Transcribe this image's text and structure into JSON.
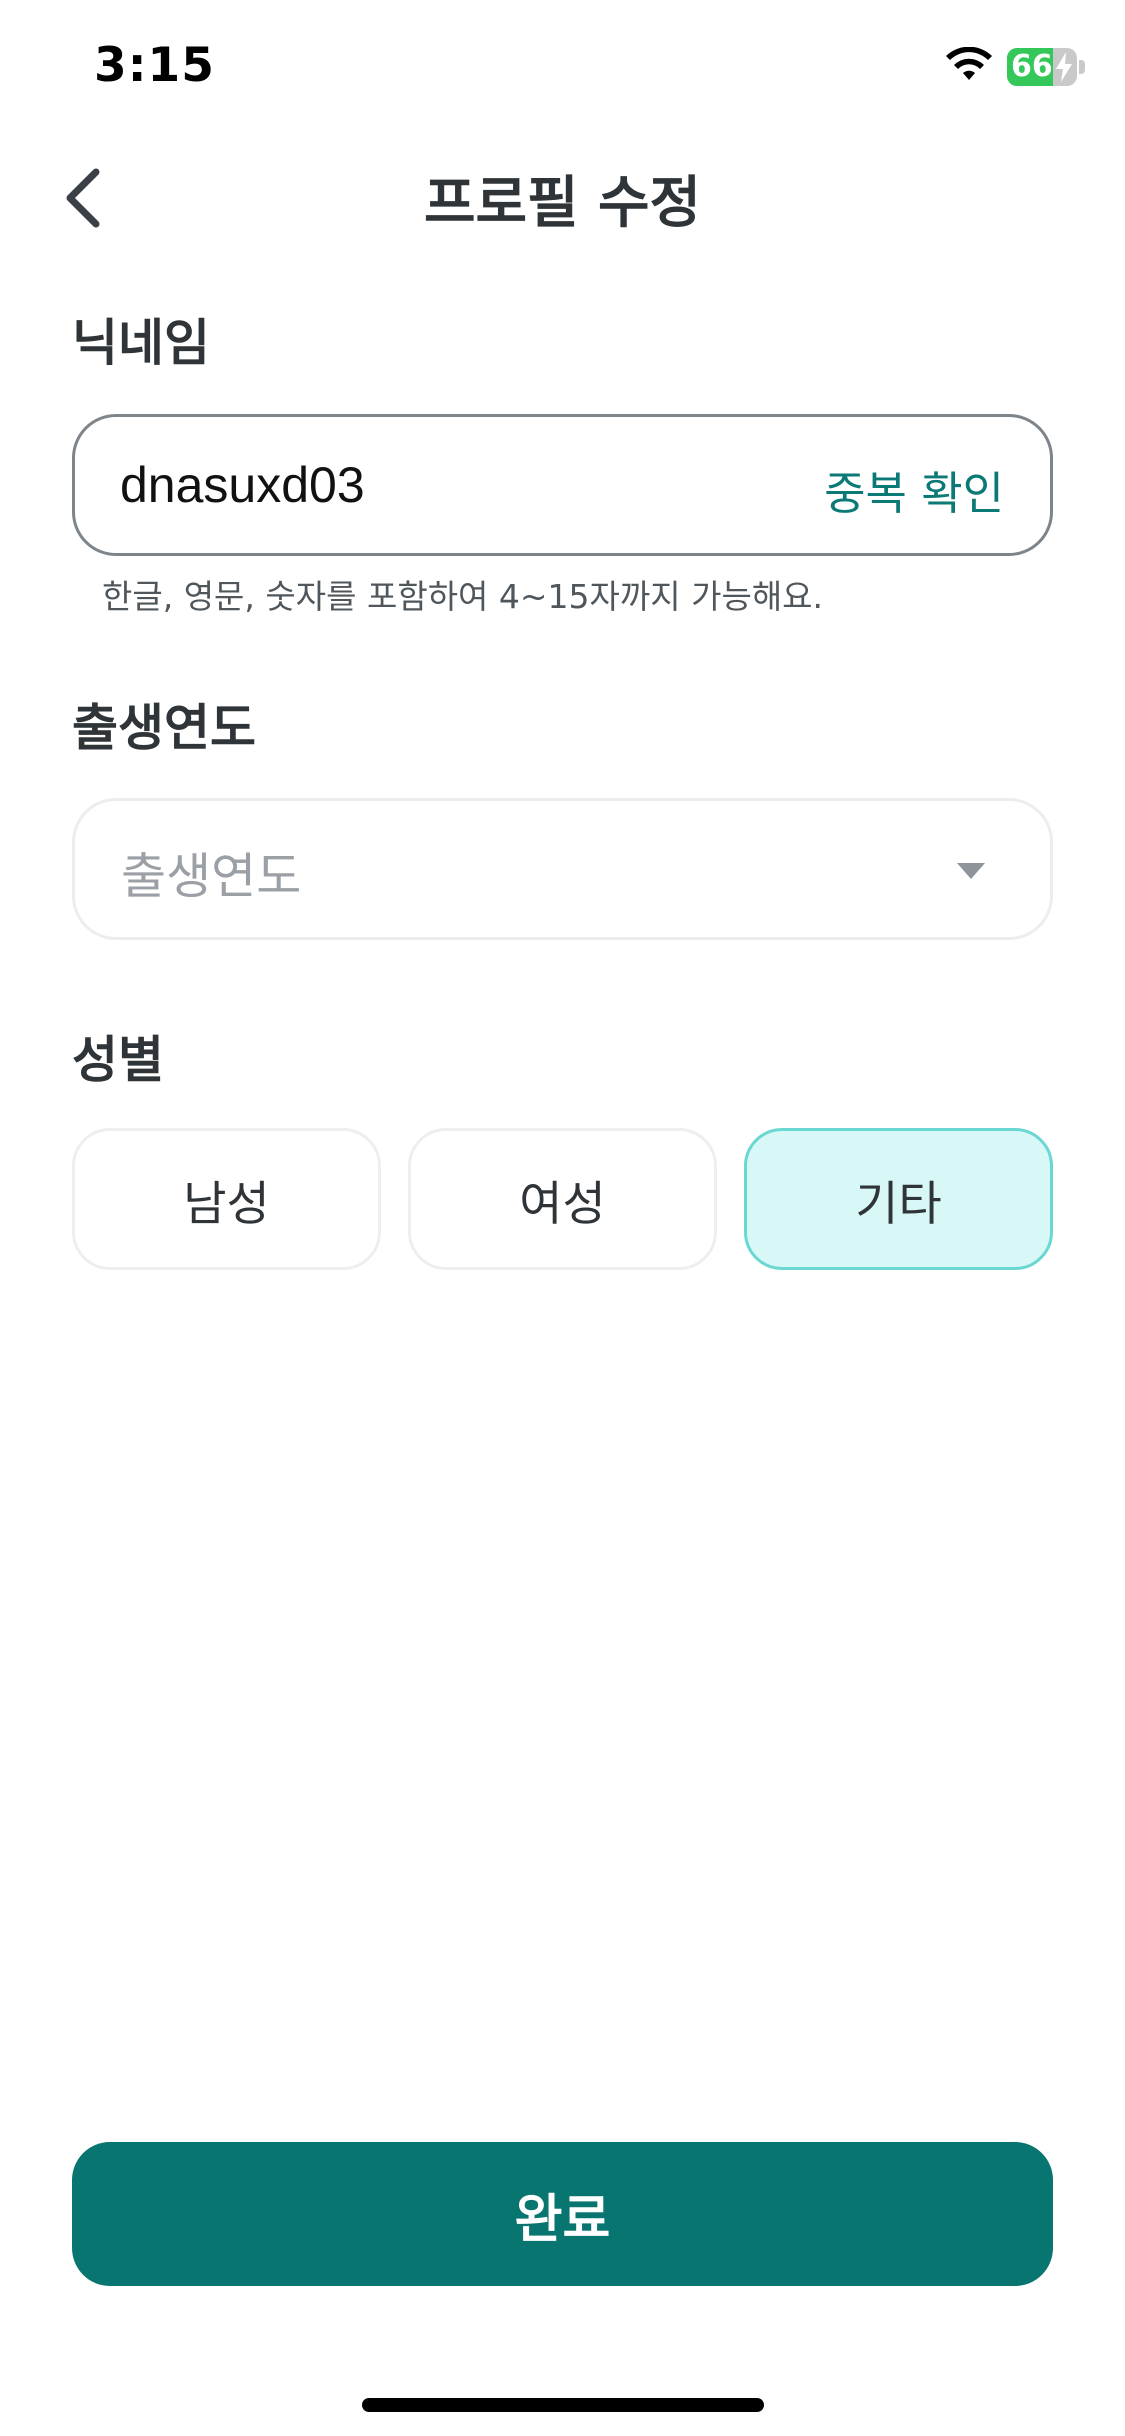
{
  "status_bar": {
    "time": "3:15",
    "battery_level": "66",
    "battery_fraction": 0.66,
    "battery_color": "#34c759"
  },
  "header": {
    "title": "프로필 수정",
    "back_icon": "chevron-left-icon"
  },
  "nickname": {
    "label": "닉네임",
    "value": "dnasuxd03",
    "check_button_label": "중복 확인",
    "helper_text": "한글, 영문, 숫자를 포함하여 4~15자까지 가능해요."
  },
  "birth_year": {
    "label": "출생연도",
    "placeholder": "출생연도",
    "dropdown_icon": "caret-down-icon"
  },
  "gender": {
    "label": "성별",
    "options": [
      {
        "label": "남성",
        "selected": false
      },
      {
        "label": "여성",
        "selected": false
      },
      {
        "label": "기타",
        "selected": true
      }
    ]
  },
  "footer": {
    "done_label": "완료",
    "done_color": "#087570"
  },
  "colors": {
    "accent": "#0b7a76",
    "selected_bg": "#d8f8f7",
    "selected_border": "#6ad7d3"
  }
}
